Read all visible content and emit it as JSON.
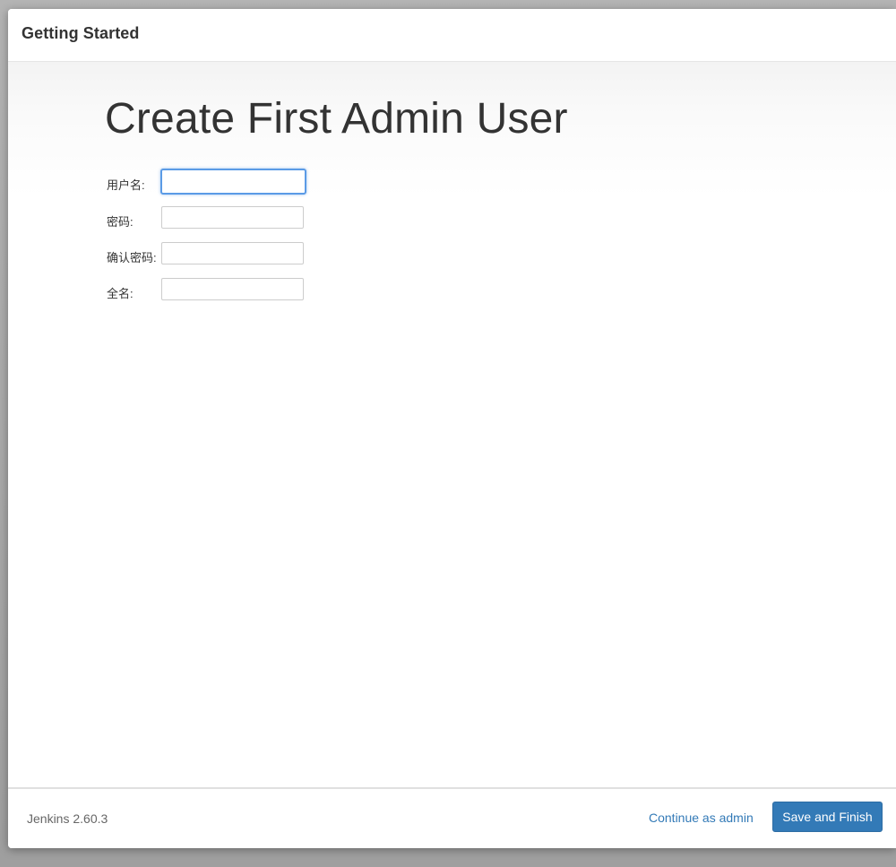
{
  "dialog": {
    "title": "Getting Started"
  },
  "main": {
    "heading": "Create First Admin User",
    "form": {
      "fields": [
        {
          "label": "用户名:",
          "value": "",
          "focused": true
        },
        {
          "label": "密码:",
          "value": ""
        },
        {
          "label": "确认密码:",
          "value": ""
        },
        {
          "label": "全名:",
          "value": ""
        }
      ]
    }
  },
  "footer": {
    "version": "Jenkins 2.60.3",
    "continue_label": "Continue as admin",
    "save_label": "Save and Finish"
  },
  "colors": {
    "accent": "#337ab7",
    "focus_ring": "#5b9be6",
    "text": "#333333"
  }
}
